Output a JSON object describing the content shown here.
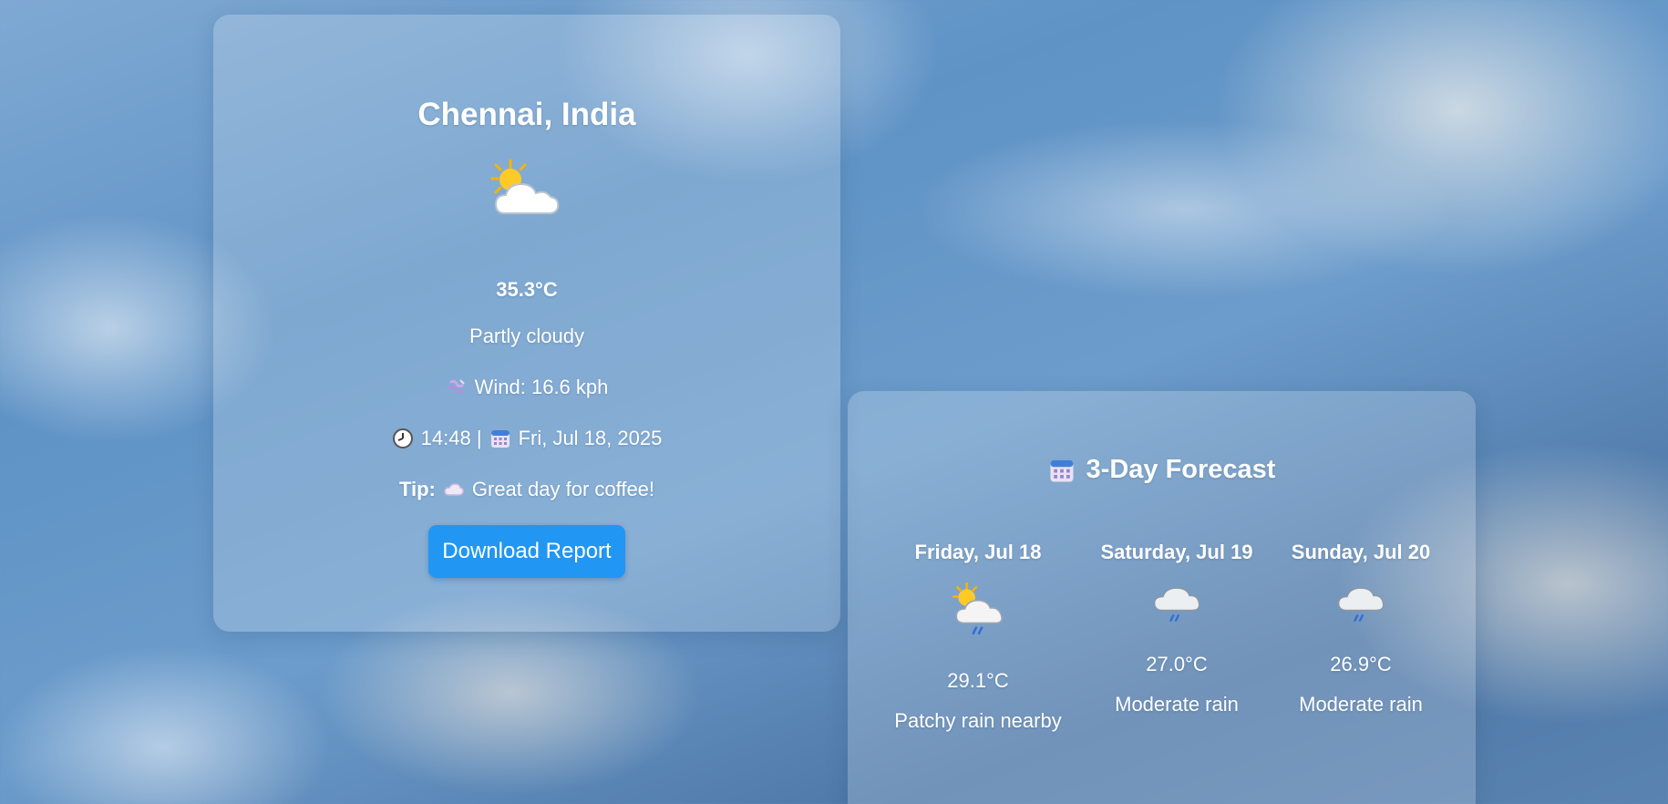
{
  "current": {
    "city": "Chennai, India",
    "weather_icon": "sun-behind-cloud-icon",
    "temperature": "35.3°C",
    "condition": "Partly cloudy",
    "wind_icon": "wind-icon",
    "wind": "Wind: 16.6 kph",
    "clock_icon": "clock-icon",
    "time": "14:48 |",
    "calendar_icon": "calendar-icon",
    "date": "Fri, Jul 18, 2025",
    "tip_label": "Tip:",
    "tip_icon": "cloud-icon",
    "tip_text": "Great day for coffee!",
    "download_label": "Download Report",
    "button_color": "#2196f3"
  },
  "forecast": {
    "title_icon": "calendar-icon",
    "title": "3-Day Forecast",
    "days": [
      {
        "name": "Friday, Jul 18",
        "icon": "sun-behind-rain-cloud-icon",
        "temp": "29.1°C",
        "condition": "Patchy rain nearby"
      },
      {
        "name": "Saturday, Jul 19",
        "icon": "rain-cloud-icon",
        "temp": "27.0°C",
        "condition": "Moderate rain"
      },
      {
        "name": "Sunday, Jul 20",
        "icon": "rain-cloud-icon",
        "temp": "26.9°C",
        "condition": "Moderate rain"
      }
    ]
  }
}
